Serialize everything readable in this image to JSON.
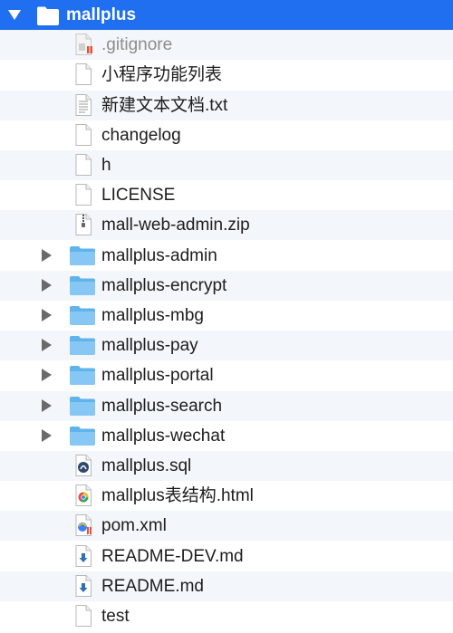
{
  "root": {
    "name": "mallplus",
    "expanded": true,
    "icon": "folder-icon"
  },
  "items": [
    {
      "name": ".gitignore",
      "type": "file",
      "icon": "gitignore-file-icon",
      "muted": true
    },
    {
      "name": "小程序功能列表",
      "type": "file",
      "icon": "blank-file-icon"
    },
    {
      "name": "新建文本文档.txt",
      "type": "file",
      "icon": "text-file-icon"
    },
    {
      "name": "changelog",
      "type": "file",
      "icon": "blank-file-icon"
    },
    {
      "name": "h",
      "type": "file",
      "icon": "blank-file-icon"
    },
    {
      "name": "LICENSE",
      "type": "file",
      "icon": "blank-file-icon"
    },
    {
      "name": "mall-web-admin.zip",
      "type": "file",
      "icon": "zip-file-icon"
    },
    {
      "name": "mallplus-admin",
      "type": "folder",
      "icon": "folder-icon"
    },
    {
      "name": "mallplus-encrypt",
      "type": "folder",
      "icon": "folder-icon"
    },
    {
      "name": "mallplus-mbg",
      "type": "folder",
      "icon": "folder-icon"
    },
    {
      "name": "mallplus-pay",
      "type": "folder",
      "icon": "folder-icon"
    },
    {
      "name": "mallplus-portal",
      "type": "folder",
      "icon": "folder-icon"
    },
    {
      "name": "mallplus-search",
      "type": "folder",
      "icon": "folder-icon"
    },
    {
      "name": "mallplus-wechat",
      "type": "folder",
      "icon": "folder-icon"
    },
    {
      "name": "mallplus.sql",
      "type": "file",
      "icon": "sql-file-icon"
    },
    {
      "name": "mallplus表结构.html",
      "type": "file",
      "icon": "html-file-icon"
    },
    {
      "name": "pom.xml",
      "type": "file",
      "icon": "xml-file-icon"
    },
    {
      "name": "README-DEV.md",
      "type": "file",
      "icon": "markdown-file-icon"
    },
    {
      "name": "README.md",
      "type": "file",
      "icon": "markdown-file-icon"
    },
    {
      "name": "test",
      "type": "file",
      "icon": "blank-file-icon"
    }
  ],
  "colors": {
    "selection": "#1f6ff0",
    "stripe": "#f3f6fa",
    "folder": "#5fb4ec"
  }
}
